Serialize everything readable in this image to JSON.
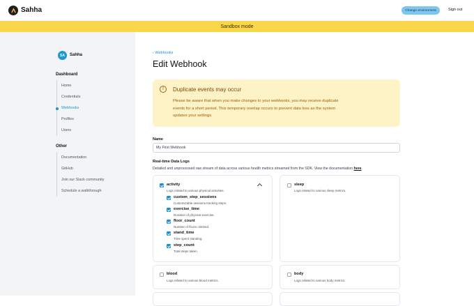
{
  "header": {
    "brand": "Sahha",
    "env_button": "Change environment",
    "sign_out": "Sign out"
  },
  "banner": {
    "text": "Sandbox mode"
  },
  "sidebar": {
    "avatar_initials": "SA",
    "username": "Sahha",
    "dashboard_title": "Dashboard",
    "dashboard_items": [
      {
        "label": "Home"
      },
      {
        "label": "Credentials"
      },
      {
        "label": "Webhooks",
        "active": true
      },
      {
        "label": "Profiles"
      },
      {
        "label": "Users"
      }
    ],
    "other_title": "Other",
    "other_items": [
      {
        "label": "Documentation"
      },
      {
        "label": "GitHub"
      },
      {
        "label": "Join our Slack community"
      },
      {
        "label": "Schedule a walkthrough"
      }
    ]
  },
  "main": {
    "back_link": "Webhooks",
    "title": "Edit Webhook",
    "alert": {
      "title": "Duplicate events may occur",
      "body": "Please be aware that when you make changes to your webhooks, you may receive duplicate events for a short period. This temporary overlap occurs to prevent data loss as the system updates your settings."
    },
    "name_label": "Name",
    "name_value": "My First Webhook",
    "logs_label": "Real-time Data Logs",
    "logs_desc": "Detailed and unprocessed raw stream of data across various health metrics streamed from the SDK. View the documentation ",
    "logs_link": "here",
    "logs_period": ".",
    "cards": {
      "activity": {
        "name": "activity",
        "desc": "Logs related to various physical activities.",
        "checked": true,
        "subs": [
          {
            "name": "custom_step_sessions",
            "desc": "Customizable sessions tracking steps."
          },
          {
            "name": "exercise_time",
            "desc": "Duration of physical exercise."
          },
          {
            "name": "floor_count",
            "desc": "Number of floors climbed."
          },
          {
            "name": "stand_time",
            "desc": "Time spent standing."
          },
          {
            "name": "step_count",
            "desc": "Total steps taken."
          }
        ]
      },
      "sleep": {
        "name": "sleep",
        "desc": "Logs related to various sleep metrics.",
        "checked": false
      },
      "blood": {
        "name": "blood",
        "desc": "Logs related to various blood metrics.",
        "checked": false
      },
      "body": {
        "name": "body",
        "desc": "Logs related to various body metrics.",
        "checked": false
      }
    }
  },
  "colors": {
    "accent": "#1d8fd0",
    "banner": "#fbd64a",
    "alert_bg": "#fef3c7",
    "env_button": "#7cc6f0"
  }
}
